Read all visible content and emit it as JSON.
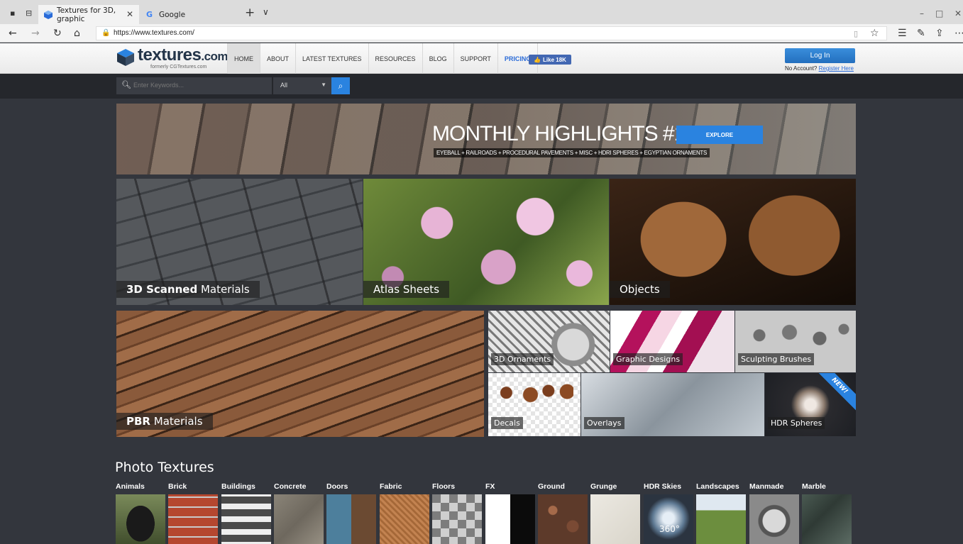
{
  "browser": {
    "tabs": [
      {
        "label": "Textures for 3D, graphic",
        "active": true
      },
      {
        "label": "Google",
        "active": false
      }
    ],
    "url": "https://www.textures.com/"
  },
  "header": {
    "logo_text": "textures",
    "logo_suffix": ".com",
    "logo_formerly": "formerly CGTextures.com",
    "nav": [
      "HOME",
      "ABOUT",
      "LATEST TEXTURES",
      "RESOURCES",
      "BLOG",
      "SUPPORT",
      "PRICING"
    ],
    "fb_like": "Like 18K",
    "login": "Log In",
    "no_account": "No Account?",
    "register": "Register Here"
  },
  "search": {
    "placeholder": "Enter Keywords...",
    "category": "All"
  },
  "banner": {
    "title": "MONTHLY HIGHLIGHTS #11",
    "cta": "EXPLORE",
    "subtitle": "EYEBALL + RAILROADS + PROCEDURAL PAVEMENTS + MISC + HDRI SPHERES + EGYPTIAN ORNAMENTS"
  },
  "tiles": {
    "scanned_bold": "3D Scanned",
    "scanned_rest": " Materials",
    "atlas": "Atlas Sheets",
    "objects": "Objects",
    "pbr_bold": "PBR",
    "pbr_rest": " Materials",
    "ornaments": "3D Ornaments",
    "graphic": "Graphic Designs",
    "sculpt": "Sculpting Brushes",
    "decals": "Decals",
    "overlays": "Overlays",
    "hdr": "HDR Spheres",
    "new_badge": "NEW!"
  },
  "photo_textures": {
    "title": "Photo Textures",
    "categories": [
      "Animals",
      "Brick",
      "Buildings",
      "Concrete",
      "Doors",
      "Fabric",
      "Floors",
      "FX",
      "Ground",
      "Grunge",
      "HDR Skies",
      "Landscapes",
      "Manmade",
      "Marble"
    ],
    "hdr_badge": "360°"
  }
}
